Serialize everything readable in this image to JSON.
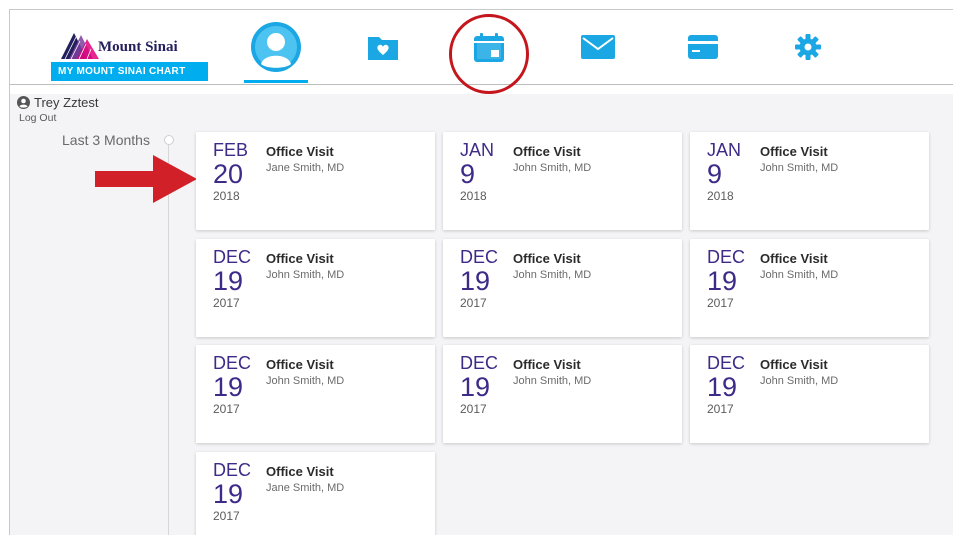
{
  "app": {
    "brand_name": "Mount Sinai",
    "chart_name": "MY MOUNT SINAI CHART",
    "accent_color": "#00aeef",
    "brand_color": "#221f5c",
    "highlight_color": "#c4161c",
    "date_color": "#3e2a87"
  },
  "nav": {
    "items": [
      {
        "icon": "profile-icon",
        "active": true
      },
      {
        "icon": "health-records-icon"
      },
      {
        "icon": "calendar-icon",
        "highlighted": true
      },
      {
        "icon": "envelope-icon"
      },
      {
        "icon": "credit-card-icon"
      },
      {
        "icon": "gear-icon"
      }
    ]
  },
  "user": {
    "name": "Trey Zztest",
    "logout_label": "Log Out"
  },
  "timeline": {
    "label": "Last 3 Months"
  },
  "visits": [
    {
      "month": "FEB",
      "day": "20",
      "year": "2018",
      "type": "Office Visit",
      "provider": "Jane Smith, MD"
    },
    {
      "month": "JAN",
      "day": "9",
      "year": "2018",
      "type": "Office Visit",
      "provider": "John Smith, MD"
    },
    {
      "month": "JAN",
      "day": "9",
      "year": "2018",
      "type": "Office Visit",
      "provider": "John Smith, MD"
    },
    {
      "month": "DEC",
      "day": "19",
      "year": "2017",
      "type": "Office Visit",
      "provider": "John Smith, MD"
    },
    {
      "month": "DEC",
      "day": "19",
      "year": "2017",
      "type": "Office Visit",
      "provider": "John Smith, MD"
    },
    {
      "month": "DEC",
      "day": "19",
      "year": "2017",
      "type": "Office Visit",
      "provider": "John Smith, MD"
    },
    {
      "month": "DEC",
      "day": "19",
      "year": "2017",
      "type": "Office Visit",
      "provider": "John Smith, MD"
    },
    {
      "month": "DEC",
      "day": "19",
      "year": "2017",
      "type": "Office Visit",
      "provider": "John Smith, MD"
    },
    {
      "month": "DEC",
      "day": "19",
      "year": "2017",
      "type": "Office Visit",
      "provider": "John Smith, MD"
    },
    {
      "month": "DEC",
      "day": "19",
      "year": "2017",
      "type": "Office Visit",
      "provider": "Jane Smith, MD"
    }
  ]
}
